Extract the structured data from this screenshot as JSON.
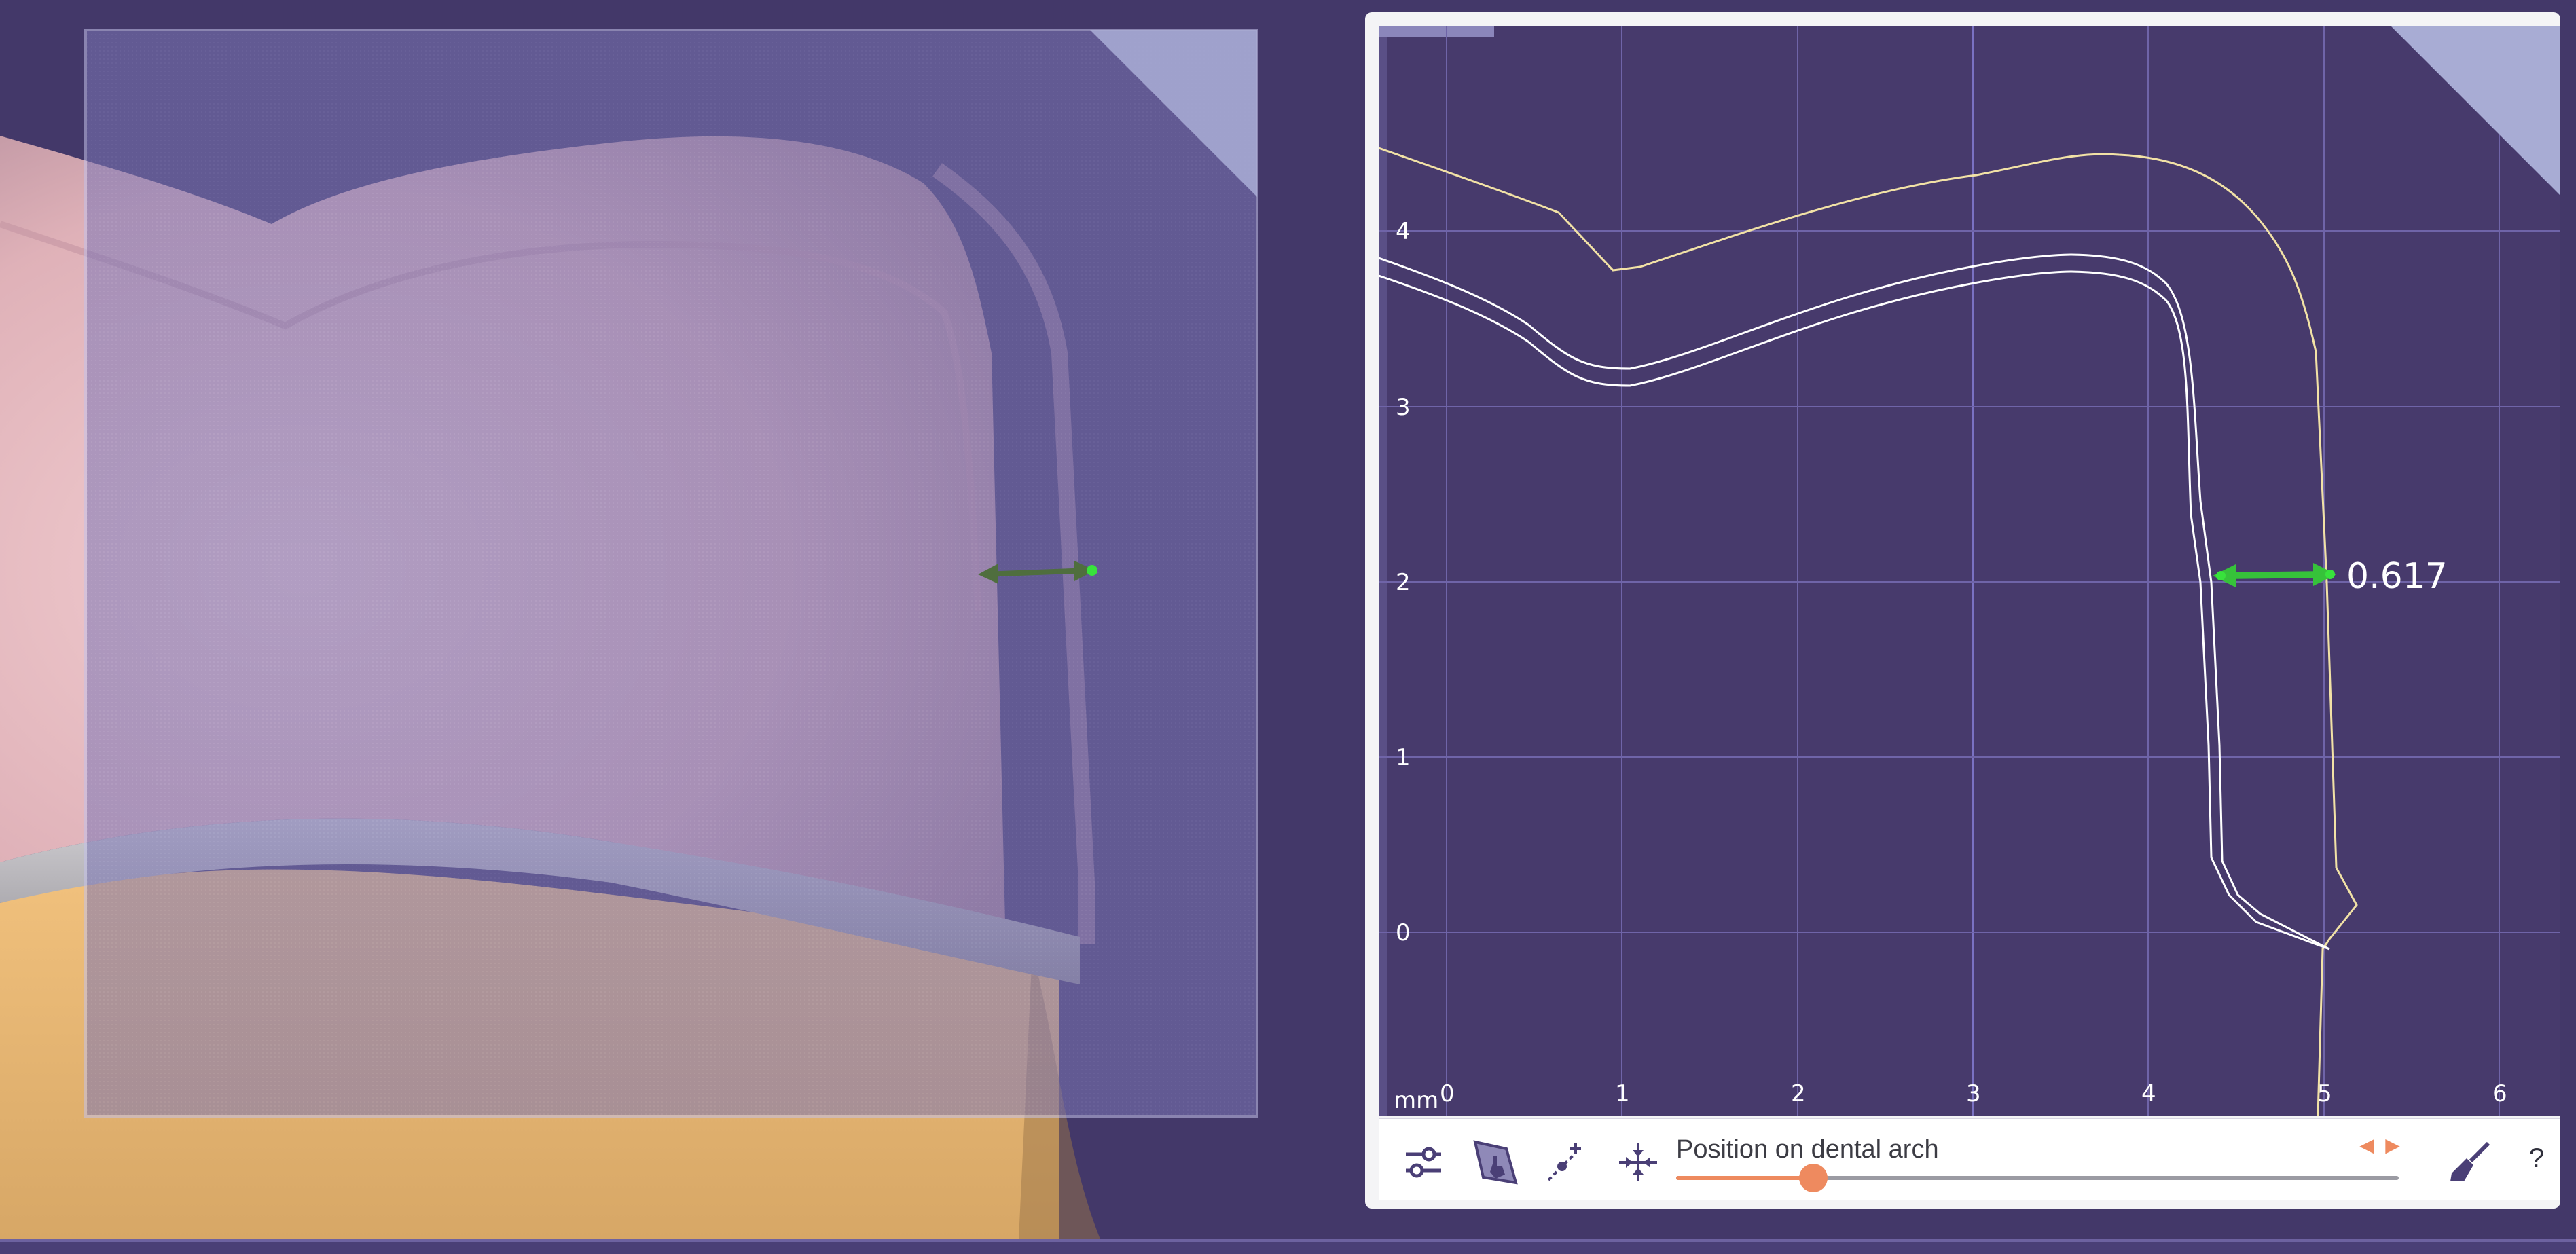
{
  "section_view": {
    "axis_unit": "mm",
    "x_ticks": [
      "0",
      "1",
      "2",
      "3",
      "4",
      "5",
      "6"
    ],
    "y_ticks": [
      "4",
      "3",
      "2",
      "1",
      "0"
    ],
    "measurement": "0.617"
  },
  "toolbar": {
    "icons": [
      "settings-sliders-icon",
      "pick-hand-icon",
      "add-point-icon",
      "fit-view-icon",
      "clean-brush-icon"
    ],
    "slider_label": "Position on dental arch",
    "slider_position": 0.19,
    "help_label": "?"
  },
  "colors": {
    "background": "#433869",
    "tooth_pink": "#e8b8c0",
    "gingiva": "#e6b371",
    "margin_band": "#b9b7bb",
    "outline_yellow": "#f2e2a6",
    "measure_green": "#36c23a",
    "slider_accent": "#ee8a5f"
  }
}
